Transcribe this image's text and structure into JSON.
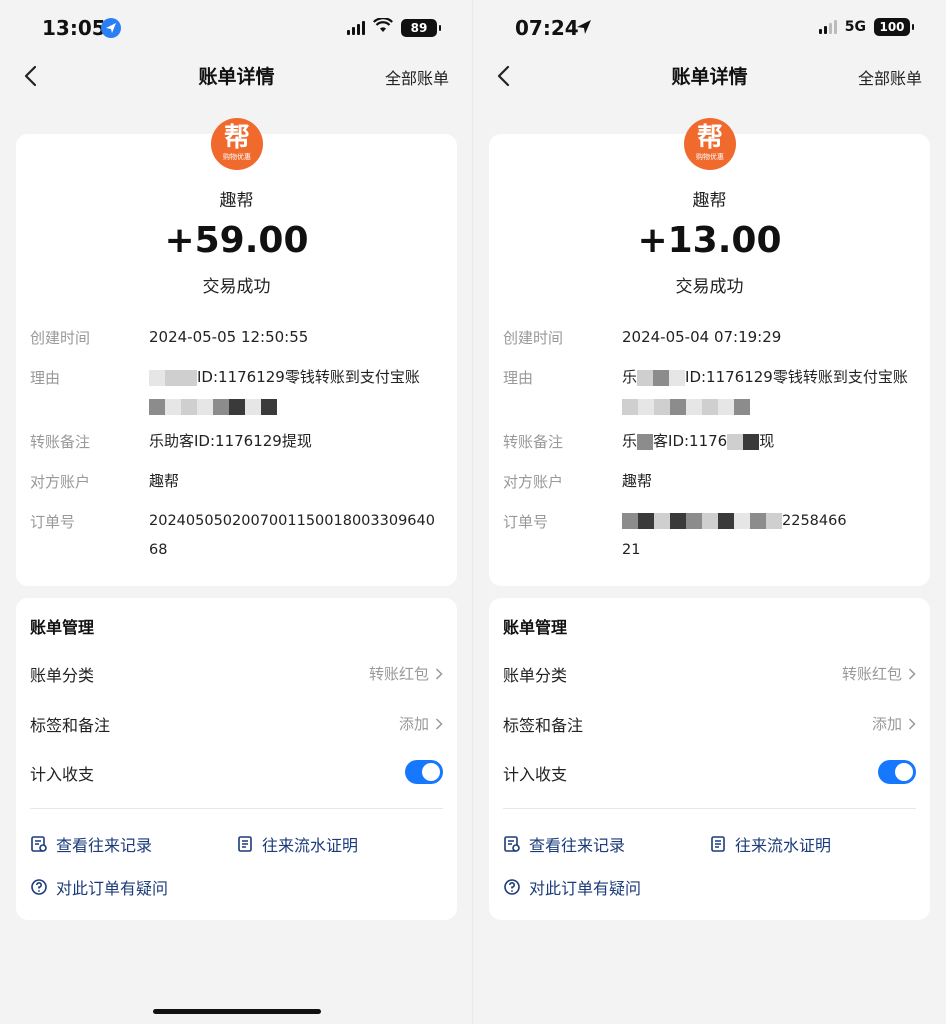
{
  "screens": [
    {
      "status": {
        "time": "13:05",
        "battery": "89",
        "network": ""
      },
      "nav": {
        "title": "账单详情",
        "all_bills": "全部账单"
      },
      "merchant": {
        "logo_text": "帮",
        "logo_subtext": "购物优惠",
        "name": "趣帮"
      },
      "amount": "+59.00",
      "result": "交易成功",
      "details": {
        "created_label": "创建时间",
        "created_value": "2024-05-05 12:50:55",
        "reason_label": "理由",
        "reason_value": "ID:1176129零钱转账到支付宝账",
        "note_label": "转账备注",
        "note_value": "乐助客ID:1176129提现",
        "counterparty_label": "对方账户",
        "counterparty_value": "趣帮",
        "order_label": "订单号",
        "order_line1": "2024050502007001150018003309640",
        "order_line2": "68"
      },
      "manage": {
        "title": "账单管理",
        "category_label": "账单分类",
        "category_value": "转账红包",
        "tag_label": "标签和备注",
        "tag_value": "添加",
        "income_label": "计入收支",
        "record_link": "查看往来记录",
        "proof_link": "往来流水证明",
        "question_link": "对此订单有疑问"
      }
    },
    {
      "status": {
        "time": "07:24",
        "battery": "100",
        "network": "5G"
      },
      "nav": {
        "title": "账单详情",
        "all_bills": "全部账单"
      },
      "merchant": {
        "logo_text": "帮",
        "logo_subtext": "购物优惠",
        "name": "趣帮"
      },
      "amount": "+13.00",
      "result": "交易成功",
      "details": {
        "created_label": "创建时间",
        "created_value": "2024-05-04 07:19:29",
        "reason_label": "理由",
        "reason_prefix": "乐",
        "reason_value": "ID:1176129零钱转账到支付宝账",
        "note_label": "转账备注",
        "note_prefix": "乐",
        "note_middle": "客ID:1176",
        "note_suffix": "现",
        "counterparty_label": "对方账户",
        "counterparty_value": "趣帮",
        "order_label": "订单号",
        "order_line1_suffix": "2258466",
        "order_line2": "21"
      },
      "manage": {
        "title": "账单管理",
        "category_label": "账单分类",
        "category_value": "转账红包",
        "tag_label": "标签和备注",
        "tag_value": "添加",
        "income_label": "计入收支",
        "record_link": "查看往来记录",
        "proof_link": "往来流水证明",
        "question_link": "对此订单有疑问"
      }
    }
  ],
  "colors": {
    "accent": "#1677ff",
    "logo": "#ef6a2c",
    "link": "#1b3b7a"
  }
}
